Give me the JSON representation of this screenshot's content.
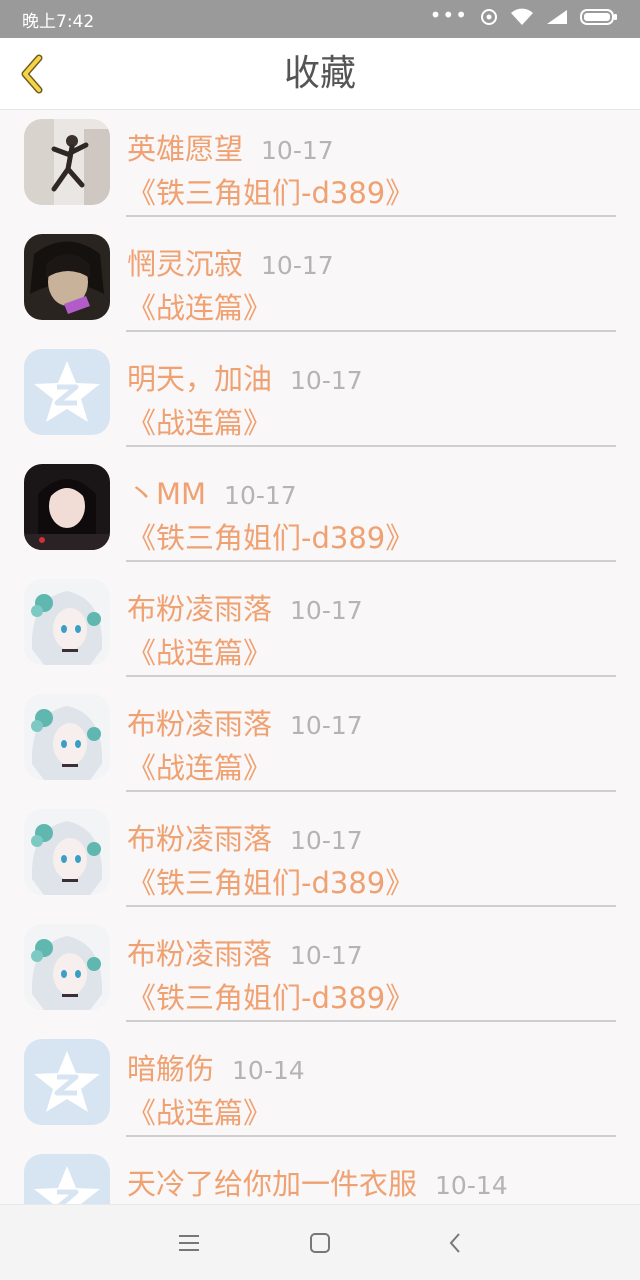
{
  "status": {
    "time": "晚上7:42",
    "dots": "•••",
    "icons": [
      "hotspot-icon",
      "wifi-icon",
      "signal-icon",
      "battery-icon"
    ]
  },
  "header": {
    "title": "收藏",
    "back_icon": "chevron-left-icon",
    "accent": "#f5d44a"
  },
  "colors": {
    "name": "#f0a171",
    "date": "#b4b4b4",
    "title": "#555555"
  },
  "items": [
    {
      "name": "英雄愿望",
      "date": "10-17",
      "book": "《铁三角姐们-d389》",
      "avatar": "photo-dancer"
    },
    {
      "name": "惘灵沉寂",
      "date": "10-17",
      "book": "《战连篇》",
      "avatar": "anime-dark"
    },
    {
      "name": "明天，加油",
      "date": "10-17",
      "book": "《战连篇》",
      "avatar": "qq-star-default"
    },
    {
      "name": "丶MM",
      "date": "10-17",
      "book": "《铁三角姐们-d389》",
      "avatar": "photo-girl"
    },
    {
      "name": "布粉凌雨落",
      "date": "10-17",
      "book": "《战连篇》",
      "avatar": "anime-white-hair"
    },
    {
      "name": "布粉凌雨落",
      "date": "10-17",
      "book": "《战连篇》",
      "avatar": "anime-white-hair"
    },
    {
      "name": "布粉凌雨落",
      "date": "10-17",
      "book": "《铁三角姐们-d389》",
      "avatar": "anime-white-hair"
    },
    {
      "name": "布粉凌雨落",
      "date": "10-17",
      "book": "《铁三角姐们-d389》",
      "avatar": "anime-white-hair"
    },
    {
      "name": "暗觞伤",
      "date": "10-14",
      "book": "《战连篇》",
      "avatar": "qq-star-default"
    },
    {
      "name": "天冷了给你加一件衣服",
      "date": "10-14",
      "book": "",
      "avatar": "qq-star-default"
    }
  ],
  "navbar": {
    "menu_icon": "menu-icon",
    "home_icon": "home-square-icon",
    "back_icon": "back-chevron-icon"
  }
}
